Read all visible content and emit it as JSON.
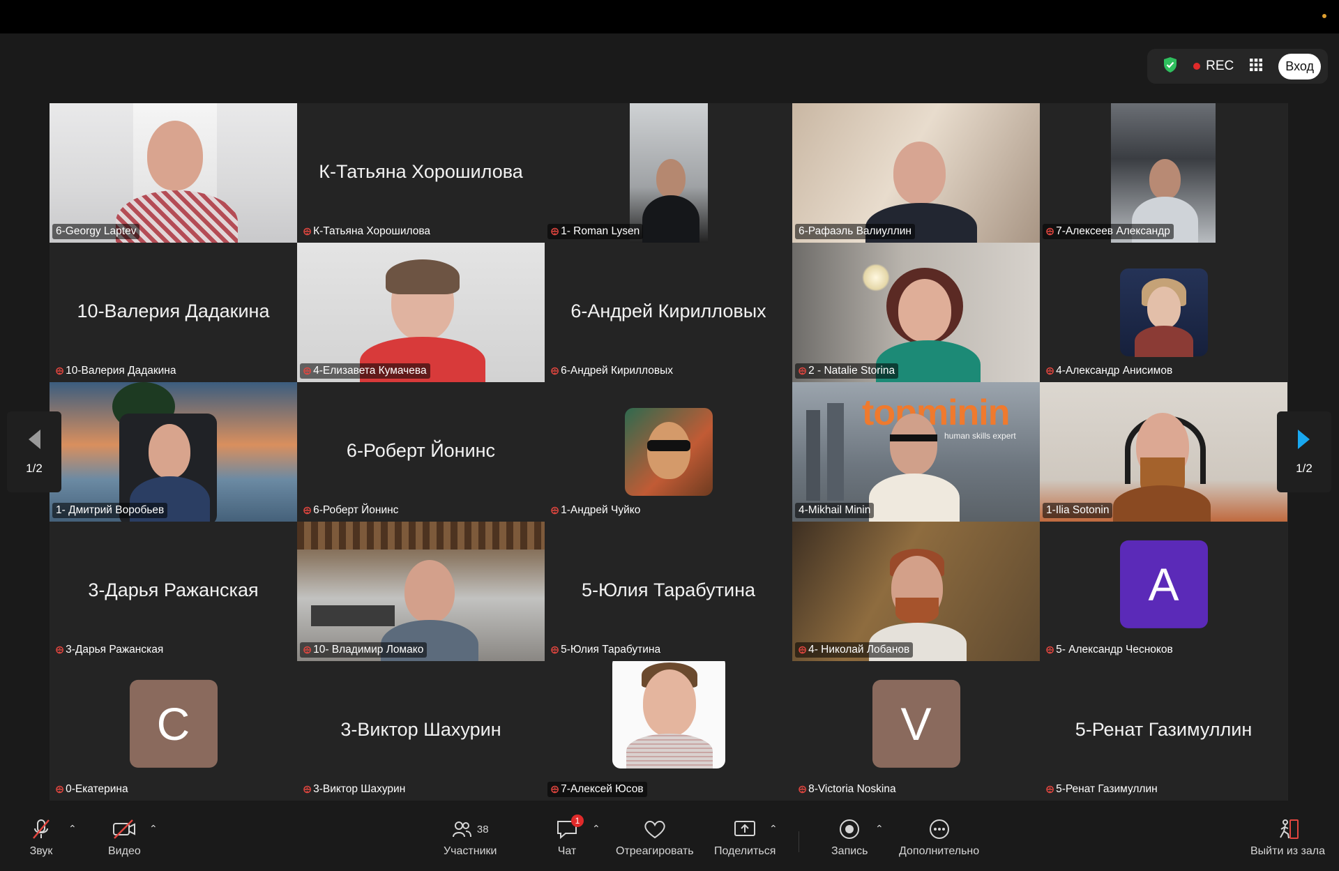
{
  "status_bar": {
    "rec_label": "REC",
    "enter_label": "Вход"
  },
  "tiles": [
    {
      "big": "",
      "label": "6-Georgy Laptev",
      "muted": false
    },
    {
      "big": "К-Татьяна Хорошилова",
      "label": "К-Татьяна Хорошилова",
      "muted": true
    },
    {
      "big": "",
      "label": "1- Roman Lysen",
      "muted": true
    },
    {
      "big": "",
      "label": "6-Рафаэль Валиуллин",
      "muted": false
    },
    {
      "big": "",
      "label": "7-Алексеев Александр",
      "muted": true
    },
    {
      "big": "10-Валерия Дадакина",
      "label": "10-Валерия Дадакина",
      "muted": true
    },
    {
      "big": "",
      "label": "4-Елизавета Кумачева",
      "muted": true
    },
    {
      "big": "6-Андрей Кирилловых",
      "label": "6-Андрей Кирилловых",
      "muted": true
    },
    {
      "big": "",
      "label": "2 - Natalie Storina",
      "muted": true
    },
    {
      "big": "",
      "label": "4-Александр Анисимов",
      "muted": true
    },
    {
      "big": "",
      "label": "1- Дмитрий Воробьев",
      "muted": false
    },
    {
      "big": "6-Роберт Йонинс",
      "label": "6-Роберт Йонинс",
      "muted": true
    },
    {
      "big": "",
      "label": "1-Андрей Чуйко",
      "muted": true
    },
    {
      "big": "",
      "label": "4-Mikhail Minin",
      "muted": false
    },
    {
      "big": "",
      "label": "1-Ilia Sotonin",
      "muted": false
    },
    {
      "big": "3-Дарья Ражанская",
      "label": "3-Дарья Ражанская",
      "muted": true
    },
    {
      "big": "",
      "label": "10- Владимир Ломако",
      "muted": true
    },
    {
      "big": "5-Юлия Тарабутина",
      "label": "5-Юлия Тарабутина",
      "muted": true
    },
    {
      "big": "",
      "label": "4- Николай Лобанов",
      "muted": true
    },
    {
      "big": "",
      "label": "5- Александр Чесноков",
      "muted": true,
      "letter": "A"
    },
    {
      "big": "",
      "label": "0-Екатерина",
      "muted": true,
      "letter": "C"
    },
    {
      "big": "3-Виктор Шахурин",
      "label": "3-Виктор Шахурин",
      "muted": true
    },
    {
      "big": "",
      "label": "7-Алексей Юсов",
      "muted": true
    },
    {
      "big": "",
      "label": "8-Victoria Noskina",
      "muted": true,
      "letter": "V"
    },
    {
      "big": "5-Ренат Газимуллин",
      "label": "5-Ренат Газимуллин",
      "muted": true
    }
  ],
  "topminin_logo": "topminin",
  "topminin_tagline": "human skills expert",
  "pager": {
    "left": "1/2",
    "right": "1/2"
  },
  "toolbar": {
    "audio": "Звук",
    "video": "Видео",
    "participants": "Участники",
    "participants_count": "38",
    "chat": "Чат",
    "chat_badge": "1",
    "react": "Отреагировать",
    "share": "Поделиться",
    "record": "Запись",
    "more": "Дополнительно",
    "leave": "Выйти из зала"
  },
  "colors": {
    "active_speaker": "#23c552",
    "muted_icon": "#e2463f",
    "avatar_A": "#5b2ab8",
    "avatar_C": "#8a6a5d",
    "avatar_V": "#8a6a5d"
  }
}
